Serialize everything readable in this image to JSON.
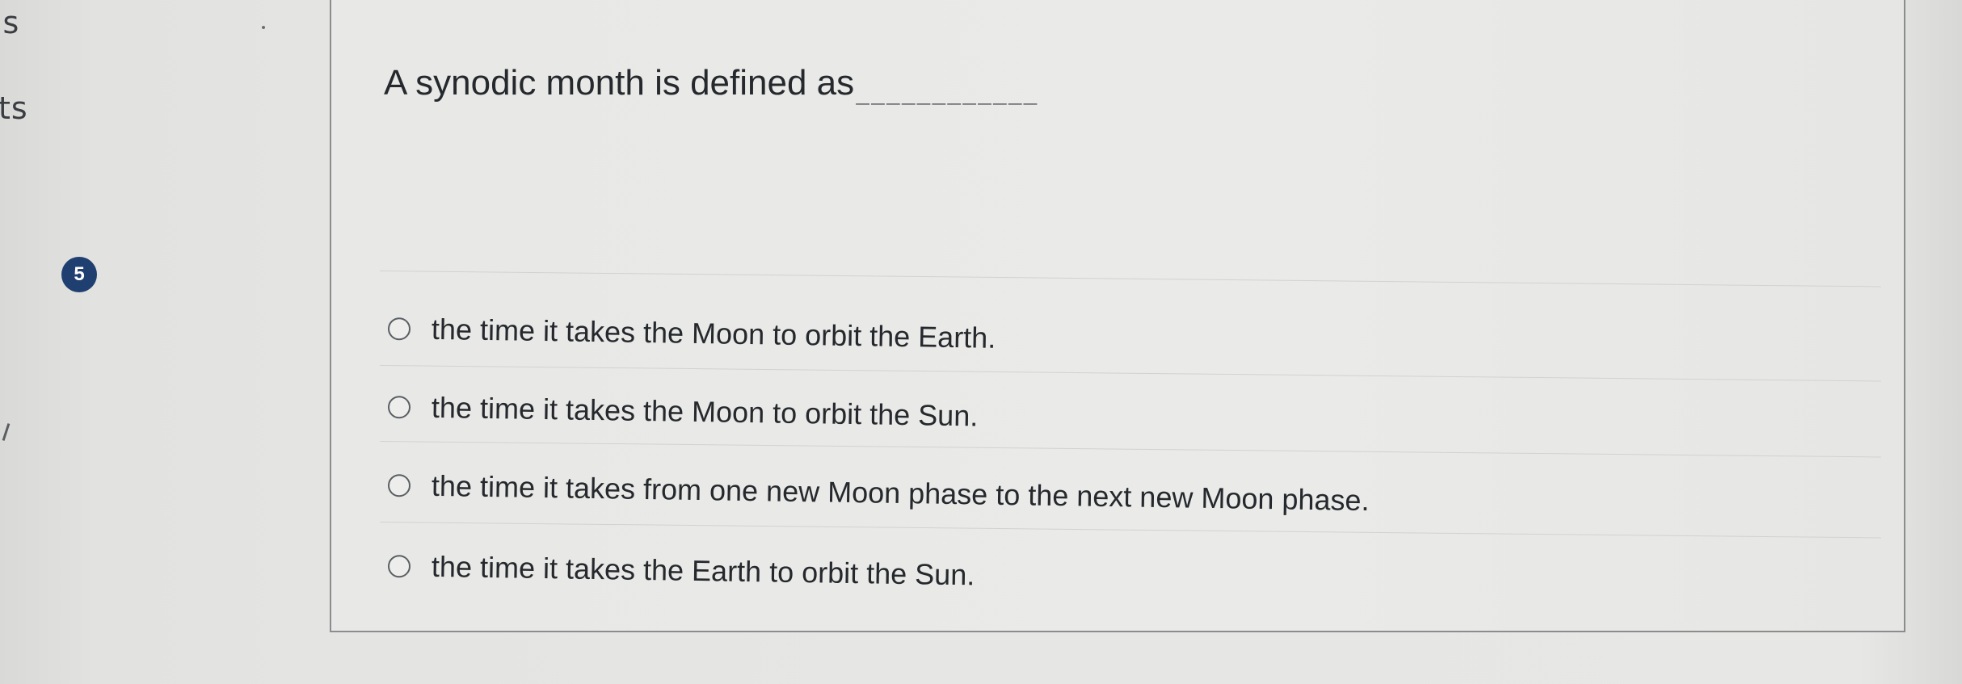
{
  "sidebar": {
    "fragment_top": "ıs",
    "fragment_mid": "ts"
  },
  "question": {
    "number": "5",
    "prompt": "A synodic month is defined as",
    "blank": "____________"
  },
  "answers": [
    {
      "label": "the time it takes the Moon to orbit the Earth."
    },
    {
      "label": "the time it takes the Moon to orbit the Sun."
    },
    {
      "label": "the time it takes from one new Moon phase to the next new Moon phase."
    },
    {
      "label": "the time it takes the Earth to orbit the Sun."
    }
  ],
  "colors": {
    "badge_bg": "#1f3f70",
    "text": "#25292d",
    "border": "#8a8c8e"
  }
}
